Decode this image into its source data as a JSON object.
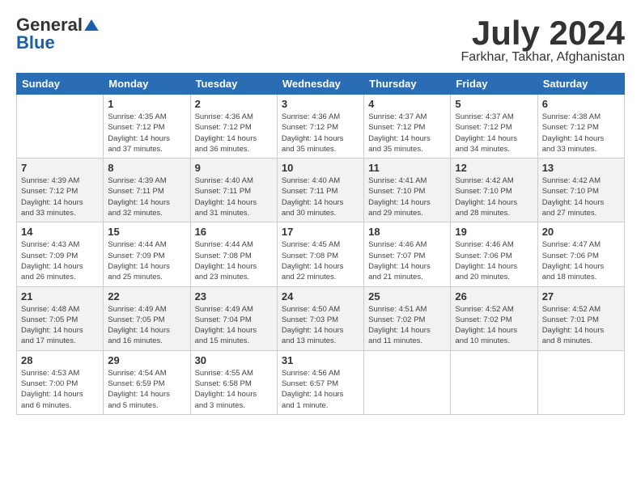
{
  "header": {
    "logo_general": "General",
    "logo_blue": "Blue",
    "month_title": "July 2024",
    "subtitle": "Farkhar, Takhar, Afghanistan"
  },
  "weekdays": [
    "Sunday",
    "Monday",
    "Tuesday",
    "Wednesday",
    "Thursday",
    "Friday",
    "Saturday"
  ],
  "weeks": [
    [
      {
        "day": "",
        "info": ""
      },
      {
        "day": "1",
        "info": "Sunrise: 4:35 AM\nSunset: 7:12 PM\nDaylight: 14 hours\nand 37 minutes."
      },
      {
        "day": "2",
        "info": "Sunrise: 4:36 AM\nSunset: 7:12 PM\nDaylight: 14 hours\nand 36 minutes."
      },
      {
        "day": "3",
        "info": "Sunrise: 4:36 AM\nSunset: 7:12 PM\nDaylight: 14 hours\nand 35 minutes."
      },
      {
        "day": "4",
        "info": "Sunrise: 4:37 AM\nSunset: 7:12 PM\nDaylight: 14 hours\nand 35 minutes."
      },
      {
        "day": "5",
        "info": "Sunrise: 4:37 AM\nSunset: 7:12 PM\nDaylight: 14 hours\nand 34 minutes."
      },
      {
        "day": "6",
        "info": "Sunrise: 4:38 AM\nSunset: 7:12 PM\nDaylight: 14 hours\nand 33 minutes."
      }
    ],
    [
      {
        "day": "7",
        "info": "Sunrise: 4:39 AM\nSunset: 7:12 PM\nDaylight: 14 hours\nand 33 minutes."
      },
      {
        "day": "8",
        "info": "Sunrise: 4:39 AM\nSunset: 7:11 PM\nDaylight: 14 hours\nand 32 minutes."
      },
      {
        "day": "9",
        "info": "Sunrise: 4:40 AM\nSunset: 7:11 PM\nDaylight: 14 hours\nand 31 minutes."
      },
      {
        "day": "10",
        "info": "Sunrise: 4:40 AM\nSunset: 7:11 PM\nDaylight: 14 hours\nand 30 minutes."
      },
      {
        "day": "11",
        "info": "Sunrise: 4:41 AM\nSunset: 7:10 PM\nDaylight: 14 hours\nand 29 minutes."
      },
      {
        "day": "12",
        "info": "Sunrise: 4:42 AM\nSunset: 7:10 PM\nDaylight: 14 hours\nand 28 minutes."
      },
      {
        "day": "13",
        "info": "Sunrise: 4:42 AM\nSunset: 7:10 PM\nDaylight: 14 hours\nand 27 minutes."
      }
    ],
    [
      {
        "day": "14",
        "info": "Sunrise: 4:43 AM\nSunset: 7:09 PM\nDaylight: 14 hours\nand 26 minutes."
      },
      {
        "day": "15",
        "info": "Sunrise: 4:44 AM\nSunset: 7:09 PM\nDaylight: 14 hours\nand 25 minutes."
      },
      {
        "day": "16",
        "info": "Sunrise: 4:44 AM\nSunset: 7:08 PM\nDaylight: 14 hours\nand 23 minutes."
      },
      {
        "day": "17",
        "info": "Sunrise: 4:45 AM\nSunset: 7:08 PM\nDaylight: 14 hours\nand 22 minutes."
      },
      {
        "day": "18",
        "info": "Sunrise: 4:46 AM\nSunset: 7:07 PM\nDaylight: 14 hours\nand 21 minutes."
      },
      {
        "day": "19",
        "info": "Sunrise: 4:46 AM\nSunset: 7:06 PM\nDaylight: 14 hours\nand 20 minutes."
      },
      {
        "day": "20",
        "info": "Sunrise: 4:47 AM\nSunset: 7:06 PM\nDaylight: 14 hours\nand 18 minutes."
      }
    ],
    [
      {
        "day": "21",
        "info": "Sunrise: 4:48 AM\nSunset: 7:05 PM\nDaylight: 14 hours\nand 17 minutes."
      },
      {
        "day": "22",
        "info": "Sunrise: 4:49 AM\nSunset: 7:05 PM\nDaylight: 14 hours\nand 16 minutes."
      },
      {
        "day": "23",
        "info": "Sunrise: 4:49 AM\nSunset: 7:04 PM\nDaylight: 14 hours\nand 15 minutes."
      },
      {
        "day": "24",
        "info": "Sunrise: 4:50 AM\nSunset: 7:03 PM\nDaylight: 14 hours\nand 13 minutes."
      },
      {
        "day": "25",
        "info": "Sunrise: 4:51 AM\nSunset: 7:02 PM\nDaylight: 14 hours\nand 11 minutes."
      },
      {
        "day": "26",
        "info": "Sunrise: 4:52 AM\nSunset: 7:02 PM\nDaylight: 14 hours\nand 10 minutes."
      },
      {
        "day": "27",
        "info": "Sunrise: 4:52 AM\nSunset: 7:01 PM\nDaylight: 14 hours\nand 8 minutes."
      }
    ],
    [
      {
        "day": "28",
        "info": "Sunrise: 4:53 AM\nSunset: 7:00 PM\nDaylight: 14 hours\nand 6 minutes."
      },
      {
        "day": "29",
        "info": "Sunrise: 4:54 AM\nSunset: 6:59 PM\nDaylight: 14 hours\nand 5 minutes."
      },
      {
        "day": "30",
        "info": "Sunrise: 4:55 AM\nSunset: 6:58 PM\nDaylight: 14 hours\nand 3 minutes."
      },
      {
        "day": "31",
        "info": "Sunrise: 4:56 AM\nSunset: 6:57 PM\nDaylight: 14 hours\nand 1 minute."
      },
      {
        "day": "",
        "info": ""
      },
      {
        "day": "",
        "info": ""
      },
      {
        "day": "",
        "info": ""
      }
    ]
  ]
}
